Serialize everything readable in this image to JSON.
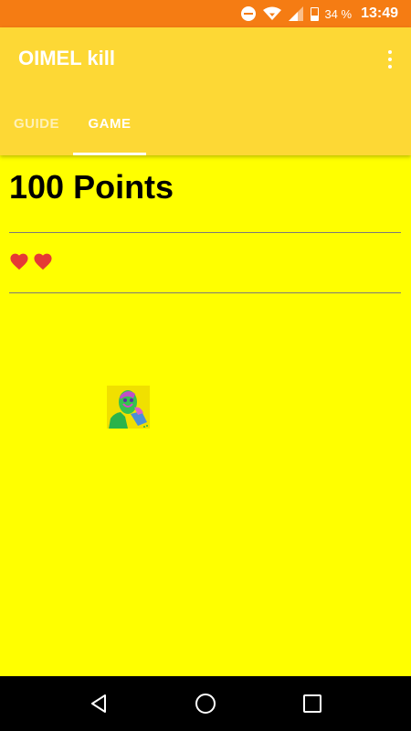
{
  "status_bar": {
    "battery_percent": "34 %",
    "time": "13:49"
  },
  "app_bar": {
    "title": "OIMEL kill"
  },
  "tabs": [
    {
      "label": "GUIDE",
      "selected": false
    },
    {
      "label": "GAME",
      "selected": true
    }
  ],
  "game": {
    "points_text": "100 Points",
    "lives": 2
  },
  "colors": {
    "status_bar": "#f57c13",
    "app_bar": "#fdd835",
    "background": "#ffff00",
    "heart": "#e53935"
  },
  "icons": {
    "status": [
      "do-not-disturb-icon",
      "wifi-icon",
      "signal-icon",
      "battery-icon"
    ],
    "nav": [
      "back-icon",
      "home-icon",
      "recents-icon"
    ],
    "overflow": "more-vert-icon"
  }
}
